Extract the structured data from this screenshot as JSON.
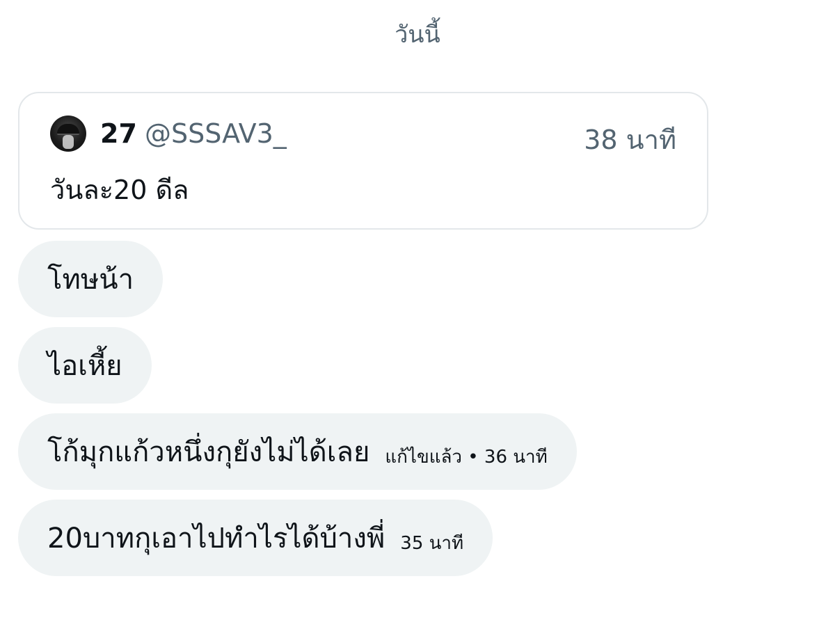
{
  "date_separator": "วันนี้",
  "quoted_post": {
    "display_name": "27",
    "handle": "@SSSAV3_",
    "time": "38 นาที",
    "text": "วันละ20 ดีล"
  },
  "messages": [
    {
      "text": "โทษน้า"
    },
    {
      "text": "ไอเหี้ย"
    },
    {
      "text": "โก้มุกแก้วหนึ่งกุยังไม่ได้เลย",
      "meta": "แก้ไขแล้ว • 36 นาที"
    },
    {
      "text": "20บาทกุเอาไปทำไรได้บ้างพี่",
      "meta": "35 นาที"
    }
  ],
  "colors": {
    "bubble_bg": "#eff3f4",
    "secondary_text": "#536471",
    "primary_text": "#0f1419",
    "card_border": "#e3e7ea"
  }
}
